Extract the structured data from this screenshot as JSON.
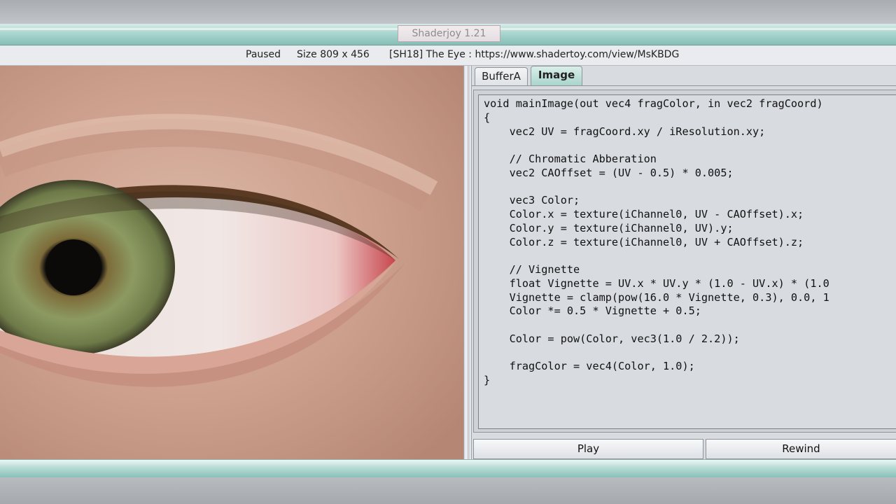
{
  "window": {
    "title": "Shaderjoy 1.21"
  },
  "status": {
    "state": "Paused",
    "size": "Size 809 x 456",
    "shader": "[SH18] The Eye : https://www.shadertoy.com/view/MsKBDG"
  },
  "tabs": [
    {
      "label": "BufferA",
      "active": false
    },
    {
      "label": "Image",
      "active": true
    }
  ],
  "code": "void mainImage(out vec4 fragColor, in vec2 fragCoord)\n{\n    vec2 UV = fragCoord.xy / iResolution.xy;\n\n    // Chromatic Abberation\n    vec2 CAOffset = (UV - 0.5) * 0.005;\n\n    vec3 Color;\n    Color.x = texture(iChannel0, UV - CAOffset).x;\n    Color.y = texture(iChannel0, UV).y;\n    Color.z = texture(iChannel0, UV + CAOffset).z;\n\n    // Vignette\n    float Vignette = UV.x * UV.y * (1.0 - UV.x) * (1.0\n    Vignette = clamp(pow(16.0 * Vignette, 0.3), 0.0, 1\n    Color *= 0.5 * Vignette + 0.5;\n\n    Color = pow(Color, vec3(1.0 / 2.2));\n\n    fragColor = vec4(Color, 1.0);\n}",
  "buttons": {
    "play": "Play",
    "rewind": "Rewind"
  },
  "icons": {
    "viewport": "shader-render-eye"
  }
}
